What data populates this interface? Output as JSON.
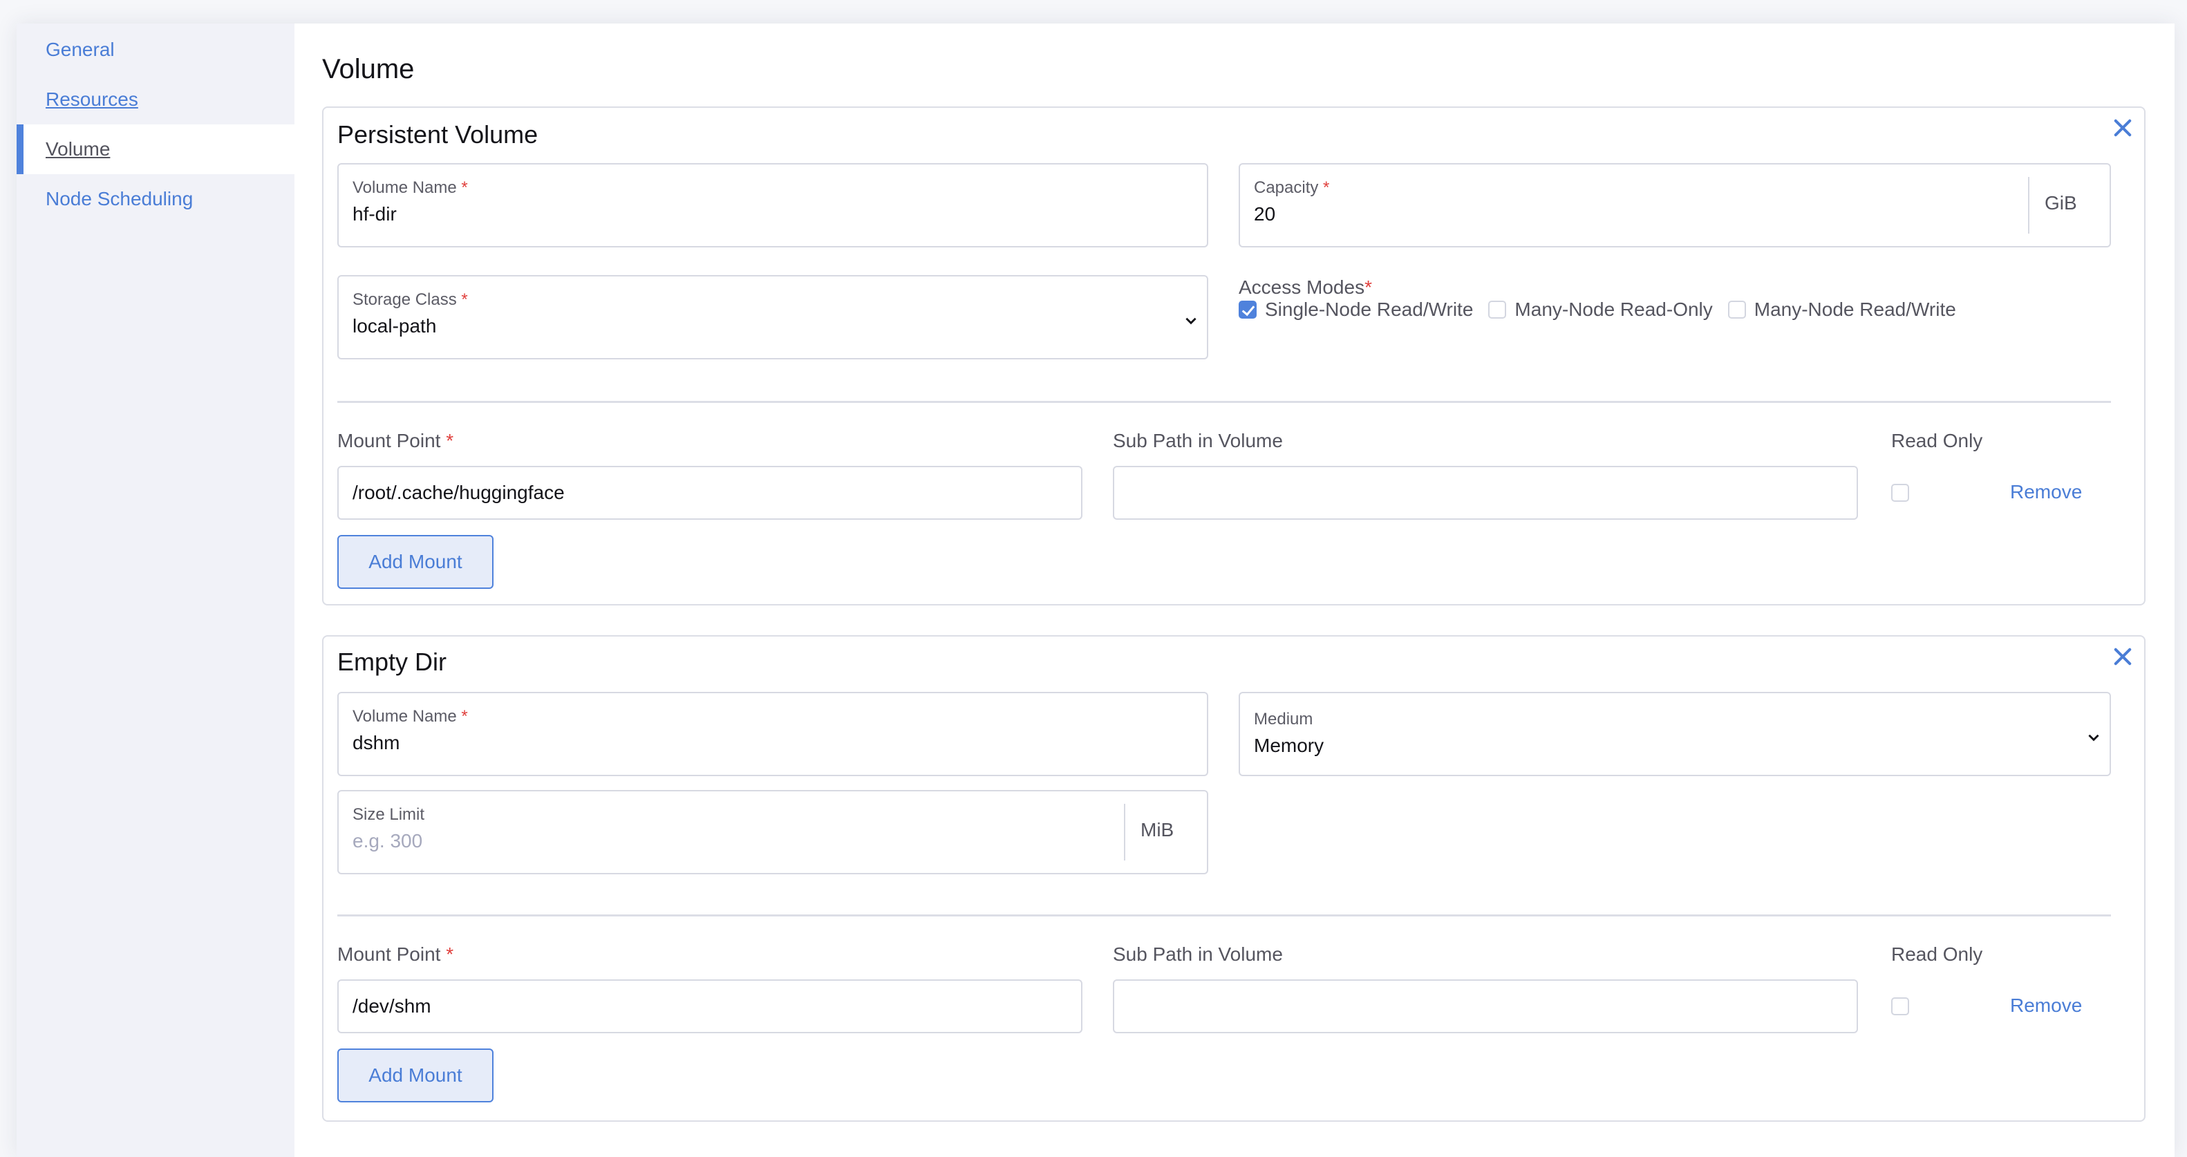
{
  "sidebar": {
    "items": [
      {
        "label": "General"
      },
      {
        "label": "Resources"
      },
      {
        "label": "Volume"
      },
      {
        "label": "Node Scheduling"
      }
    ]
  },
  "page": {
    "title": "Volume"
  },
  "persistent_volume": {
    "title": "Persistent Volume",
    "volume_name": {
      "label": "Volume Name",
      "required": "*",
      "value": "hf-dir"
    },
    "capacity": {
      "label": "Capacity",
      "required": "*",
      "value": "20",
      "unit": "GiB"
    },
    "storage_class": {
      "label": "Storage Class",
      "required": "*",
      "value": "local-path"
    },
    "access_modes": {
      "label": "Access Modes",
      "required": "*",
      "options": [
        {
          "label": "Single-Node Read/Write",
          "checked": true
        },
        {
          "label": "Many-Node Read-Only",
          "checked": false
        },
        {
          "label": "Many-Node Read/Write",
          "checked": false
        }
      ]
    },
    "mount": {
      "mount_point_label": "Mount Point",
      "required": "*",
      "sub_path_label": "Sub Path in Volume",
      "read_only_label": "Read Only",
      "mount_point_value": "/root/.cache/huggingface",
      "sub_path_value": "",
      "read_only": false,
      "remove_label": "Remove",
      "add_label": "Add Mount"
    }
  },
  "empty_dir": {
    "title": "Empty Dir",
    "volume_name": {
      "label": "Volume Name",
      "required": "*",
      "value": "dshm"
    },
    "medium": {
      "label": "Medium",
      "value": "Memory"
    },
    "size_limit": {
      "label": "Size Limit",
      "placeholder": "e.g. 300",
      "value": "",
      "unit": "MiB"
    },
    "mount": {
      "mount_point_label": "Mount Point",
      "required": "*",
      "sub_path_label": "Sub Path in Volume",
      "read_only_label": "Read Only",
      "mount_point_value": "/dev/shm",
      "sub_path_value": "",
      "read_only": false,
      "remove_label": "Remove",
      "add_label": "Add Mount"
    }
  },
  "colors": {
    "accent": "#4f82dc",
    "link": "#4a7dd6",
    "required": "#e0413e"
  }
}
